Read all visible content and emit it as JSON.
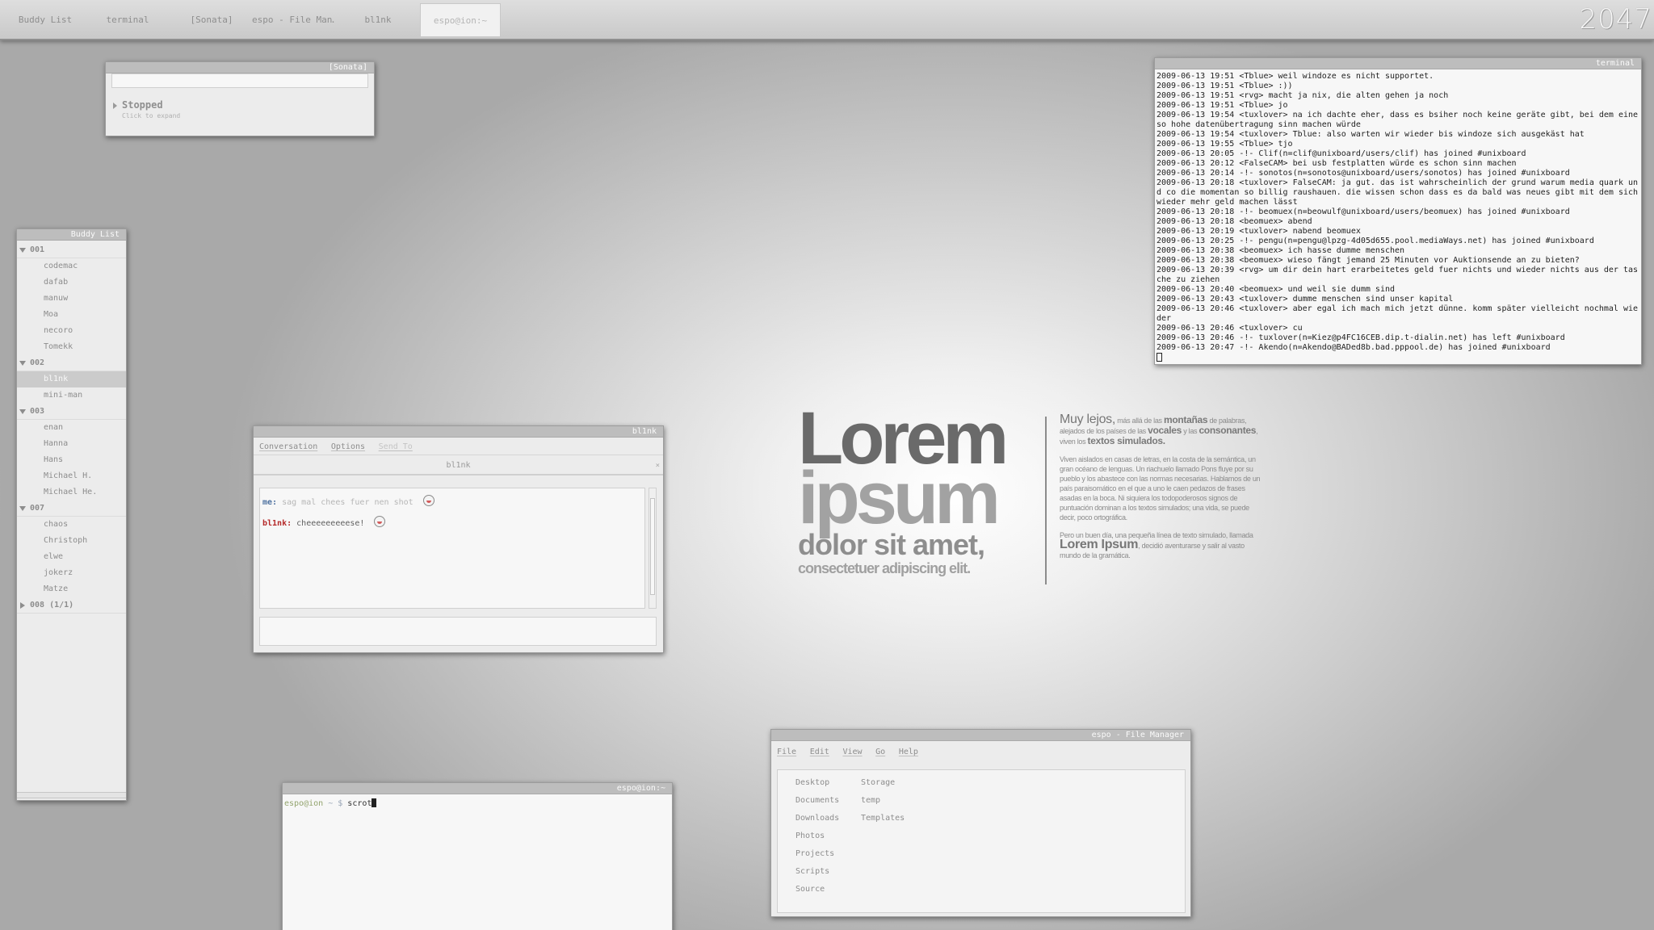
{
  "taskbar": {
    "items": [
      {
        "label": "Buddy List"
      },
      {
        "label": "terminal"
      },
      {
        "label": "[Sonata]"
      },
      {
        "label": "espo - File Man…"
      },
      {
        "label": "bl1nk"
      },
      {
        "label": "espo@ion:~"
      }
    ],
    "active_index": 5,
    "clock": "2047"
  },
  "sonata": {
    "title": "[Sonata]",
    "status": "Stopped",
    "hint": "Click to expand"
  },
  "buddy_list": {
    "title": "Buddy List",
    "groups": [
      {
        "name": "001",
        "expanded": true,
        "buddies": [
          "codemac",
          "dafab",
          "manuw",
          "Moa",
          "necoro",
          "Tomekk"
        ]
      },
      {
        "name": "002",
        "expanded": true,
        "buddies": [
          "bl1nk",
          "mini-man"
        ]
      },
      {
        "name": "003",
        "expanded": true,
        "buddies": [
          "enan",
          "Hanna",
          "Hans",
          "Michael H.",
          "Michael He."
        ]
      },
      {
        "name": "007",
        "expanded": true,
        "buddies": [
          "chaos",
          "Christoph",
          "elwe",
          "jokerz",
          "Matze"
        ]
      },
      {
        "name": "008 (1/1)",
        "expanded": false,
        "buddies": []
      }
    ],
    "selected": "bl1nk"
  },
  "chat": {
    "title": "bl1nk",
    "menu": {
      "conversation": "Conversation",
      "options": "Options",
      "send_to": "Send To"
    },
    "tab_label": "bl1nk",
    "tab_close": "×",
    "messages": [
      {
        "nick": "me:",
        "text": "sag mal chees fuer nen shot"
      },
      {
        "nick": "bl1nk:",
        "text": "cheeeeeeeeese!"
      }
    ]
  },
  "irc_terminal": {
    "title": "terminal",
    "lines": [
      "2009-06-13 19:51 <Tblue> weil windoze es nicht supportet.",
      "2009-06-13 19:51 <Tblue> :))",
      "2009-06-13 19:51 <rvg> macht ja nix, die alten gehen ja noch",
      "2009-06-13 19:51 <Tblue> jo",
      "2009-06-13 19:54 <tuxlover> na ich dachte eher, dass es bsiher noch keine geräte gibt, bei dem eine so hohe datenübertragung sinn machen würde",
      "2009-06-13 19:54 <tuxlover> Tblue: also warten wir wieder bis windoze sich ausgekäst hat",
      "2009-06-13 19:55 <Tblue> tjo",
      "2009-06-13 20:05 -!- Clif(n=clif@unixboard/users/clif) has joined #unixboard",
      "2009-06-13 20:12 <FalseCAM> bei usb festplatten würde es schon sinn machen",
      "2009-06-13 20:14 -!- sonotos(n=sonotos@unixboard/users/sonotos) has joined #unixboard",
      "2009-06-13 20:18 <tuxlover> FalseCAM: ja gut. das ist wahrscheinlich der grund warum media quark und co die momentan so billig raushauen. die wissen schon dass es da bald was neues gibt mit dem sich wieder mehr geld machen lässt",
      "2009-06-13 20:18 -!- beomuex(n=beowulf@unixboard/users/beomuex) has joined #unixboard",
      "2009-06-13 20:18 <beomuex> abend",
      "2009-06-13 20:19 <tuxlover> nabend beomuex",
      "2009-06-13 20:25 -!- pengu(n=pengu@lpzg-4d05d655.pool.mediaWays.net) has joined #unixboard",
      "2009-06-13 20:38 <beomuex> ich hasse dumme menschen",
      "2009-06-13 20:38 <beomuex> wieso fängt jemand 25 Minuten vor Auktionsende an zu bieten?",
      "2009-06-13 20:39 <rvg> um dir dein hart erarbeitetes geld fuer nichts und wieder nichts aus der tasche zu ziehen",
      "2009-06-13 20:40 <beomuex> und weil sie dumm sind",
      "2009-06-13 20:43 <tuxlover> dumme menschen sind unser kapital",
      "2009-06-13 20:46 <tuxlover> aber egal ich mach mich jetzt dünne. komm später vielleicht nochmal wieder",
      "2009-06-13 20:46 <tuxlover> cu",
      "2009-06-13 20:46 -!- tuxlover(n=Kiez@p4FC16CEB.dip.t-dialin.net) has left #unixboard",
      "2009-06-13 20:47 -!- Akendo(n=Akendo@BADed8b.bad.pppool.de) has joined #unixboard"
    ]
  },
  "shell_terminal": {
    "title": "espo@ion:~",
    "prompt_user": "espo@ion",
    "prompt_dir": "~ $",
    "command": "scrot"
  },
  "file_manager": {
    "title": "espo - File Manager",
    "menu": {
      "file": "File",
      "edit": "Edit",
      "view": "View",
      "go": "Go",
      "help": "Help"
    },
    "col1": [
      "Desktop",
      "Documents",
      "Downloads",
      "Photos",
      "Projects",
      "Scripts",
      "Source"
    ],
    "col2": [
      "Storage",
      "temp",
      "Templates"
    ]
  },
  "wallpaper": {
    "big1": "Lorem",
    "big2": "ipsum",
    "big3": "dolor sit amet,",
    "big4": "consectetuer adipiscing elit.",
    "p1_a": "Muy lejos,",
    "p1_b": " más allá de las ",
    "p1_c": "montañas",
    "p1_d": " de palabras, alejados de los países de las ",
    "p1_e": "vocales",
    "p1_f": " y las ",
    "p1_g": "consonantes",
    "p1_h": ", viven los ",
    "p1_i": "textos simulados.",
    "p2": "Viven aislados en casas de letras, en la costa de la semántica, un gran océano de lenguas. Un riachuelo llamado Pons fluye por su pueblo y los abastece con las normas necesarias. Hablamos de un país paraisomático en el que a uno le caen pedazos de frases asadas en la boca. Ni siquiera los todopoderosos signos de puntuación dominan a los textos simulados; una vida, se puede decir, poco ortográfica.",
    "p3_a": "Pero un buen día, una pequeña línea de texto simulado, llamada ",
    "p3_b": "Lorem Ipsum",
    "p3_c": ", decidió aventurarse y salir al vasto mundo de la gramática."
  }
}
